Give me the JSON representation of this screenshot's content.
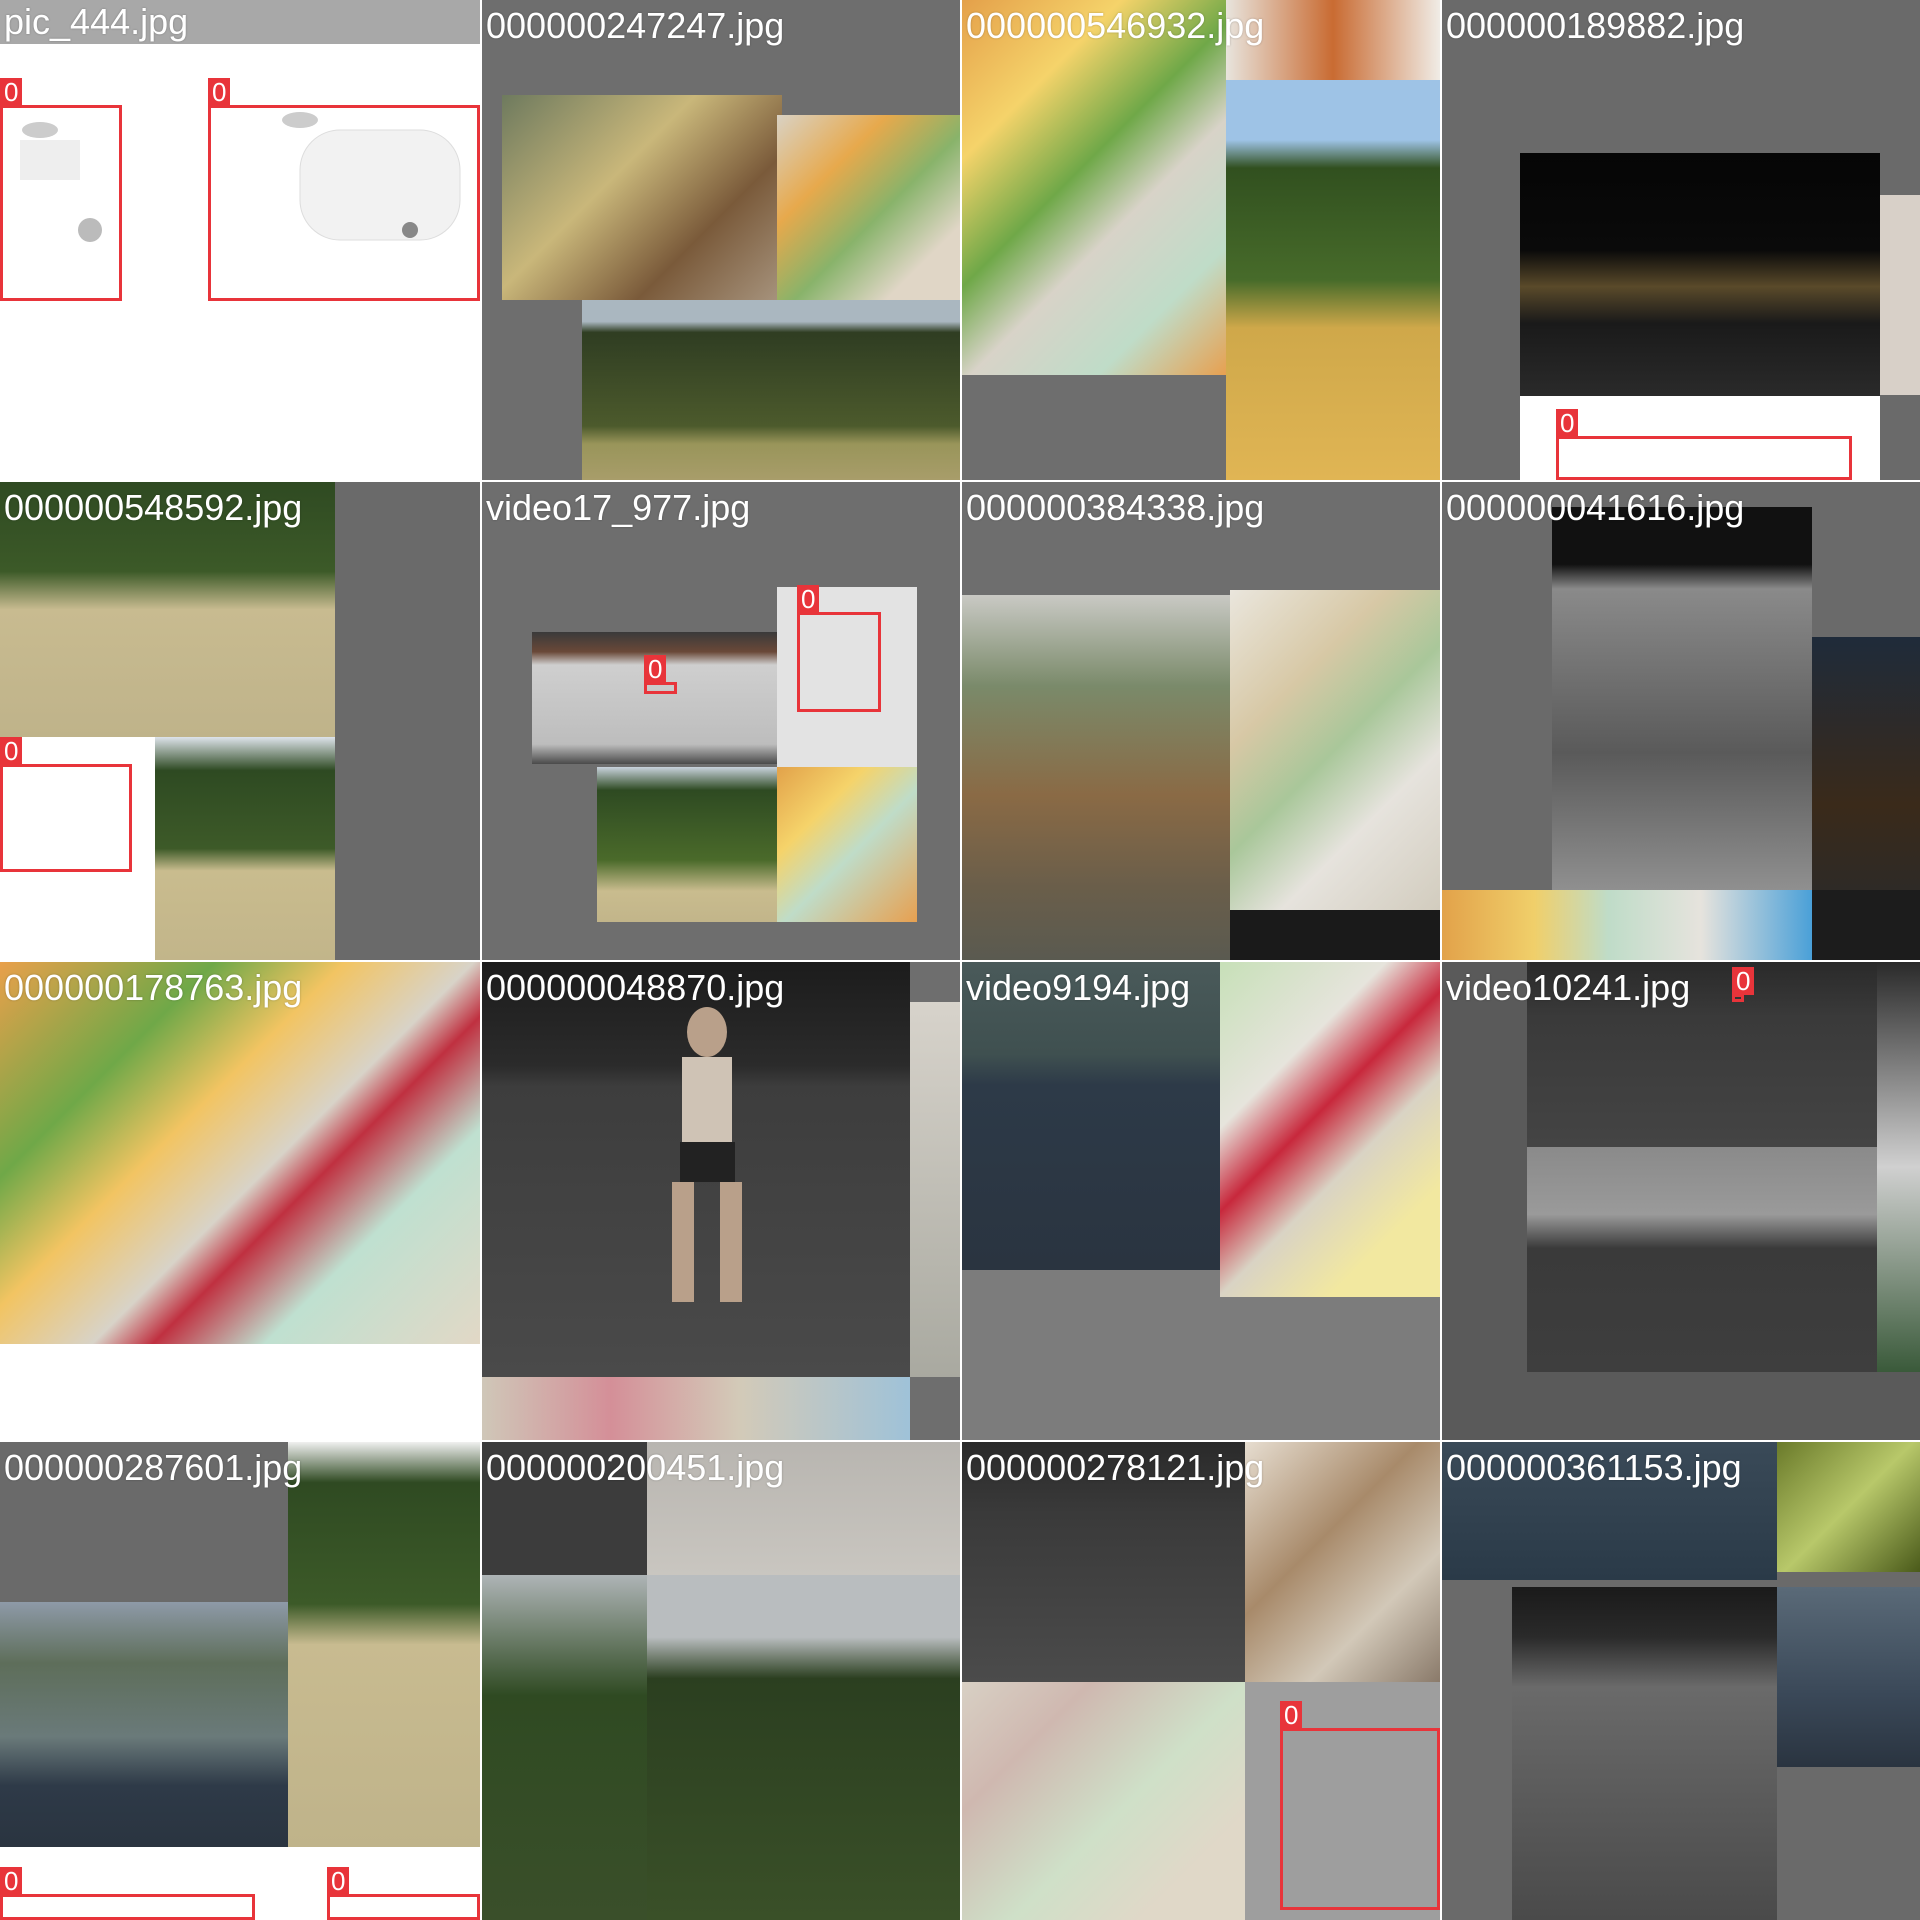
{
  "mosaic": {
    "tiles": [
      {
        "filename": "pic_444.jpg",
        "labels": [
          "0",
          "0"
        ]
      },
      {
        "filename": "000000247247.jpg",
        "labels": []
      },
      {
        "filename": "000000546932.jpg",
        "labels": []
      },
      {
        "filename": "000000189882.jpg",
        "labels": [
          "0"
        ]
      },
      {
        "filename": "000000548592.jpg",
        "labels": [
          "0"
        ]
      },
      {
        "filename": "video17_977.jpg",
        "labels": [
          "0",
          "0"
        ]
      },
      {
        "filename": "000000384338.jpg",
        "labels": []
      },
      {
        "filename": "000000041616.jpg",
        "labels": []
      },
      {
        "filename": "000000178763.jpg",
        "labels": []
      },
      {
        "filename": "000000048870.jpg",
        "labels": []
      },
      {
        "filename": "video9194.jpg",
        "labels": []
      },
      {
        "filename": "video10241.jpg",
        "labels": [
          "0"
        ]
      },
      {
        "filename": "000000287601.jpg",
        "labels": [
          "0",
          "0"
        ]
      },
      {
        "filename": "000000200451.jpg",
        "labels": []
      },
      {
        "filename": "000000278121.jpg",
        "labels": [
          "0"
        ]
      },
      {
        "filename": "000000361153.jpg",
        "labels": []
      }
    ]
  },
  "colors": {
    "box": "#e8343a",
    "pad": "#727272"
  }
}
